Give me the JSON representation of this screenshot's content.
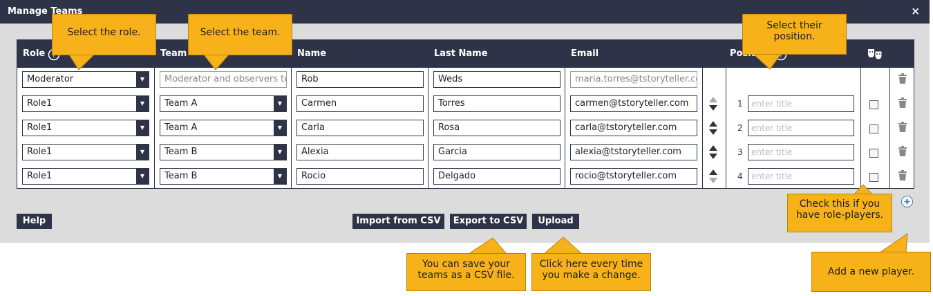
{
  "window": {
    "title": "Manage Teams",
    "close_label": "×"
  },
  "headers": {
    "role": "Role",
    "team": "Team",
    "name": "Name",
    "last_name": "Last Name",
    "email": "Email",
    "position": "Position"
  },
  "rows": [
    {
      "role": "Moderator",
      "team": "Moderator and observers team",
      "name": "Rob",
      "last": "Weds",
      "email": "maria.torres@tstoryteller.com",
      "num": "",
      "title_placeholder": ""
    },
    {
      "role": "Role1",
      "team": "Team A",
      "name": "Carmen",
      "last": "Torres",
      "email": "carmen@tstoryteller.com",
      "num": "1",
      "title_placeholder": "enter title"
    },
    {
      "role": "Role1",
      "team": "Team A",
      "name": "Carla",
      "last": "Rosa",
      "email": "carla@tstoryteller.com",
      "num": "2",
      "title_placeholder": "enter title"
    },
    {
      "role": "Role1",
      "team": "Team B",
      "name": "Alexia",
      "last": "Garcia",
      "email": "alexia@tstoryteller.com",
      "num": "3",
      "title_placeholder": "enter title"
    },
    {
      "role": "Role1",
      "team": "Team B",
      "name": "Rocio",
      "last": "Delgado",
      "email": "rocio@tstoryteller.com",
      "num": "4",
      "title_placeholder": "enter title"
    }
  ],
  "buttons": {
    "help": "Help",
    "import": "Import from CSV",
    "export": "Export to CSV",
    "upload": "Upload"
  },
  "callouts": {
    "role": "Select the role.",
    "team": "Select the team.",
    "position": "Select their position.",
    "roleplayers": "Check this if you have role-players.",
    "csv": "You can save your teams as a CSV file.",
    "upload": "Click here every time you make a change.",
    "add": "Add a new player."
  },
  "colors": {
    "header": "#2f3347",
    "callout": "#f7b21a",
    "panel": "#dcdcdc"
  },
  "icons": [
    "close-icon",
    "help-icon",
    "masks-icon",
    "sort-icon",
    "trash-icon",
    "add-icon",
    "chevron-down-icon"
  ]
}
